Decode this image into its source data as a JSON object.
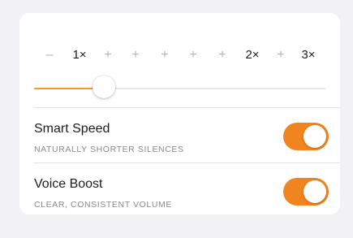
{
  "speed": {
    "ticks": [
      {
        "label": "–",
        "major": false
      },
      {
        "label": "1×",
        "major": true
      },
      {
        "label": "+",
        "major": false
      },
      {
        "label": "+",
        "major": false
      },
      {
        "label": "+",
        "major": false
      },
      {
        "label": "+",
        "major": false
      },
      {
        "label": "+",
        "major": false
      },
      {
        "label": "2×",
        "major": true
      },
      {
        "label": "+",
        "major": false
      },
      {
        "label": "3×",
        "major": true
      }
    ],
    "slider_level": 0.24,
    "accent_color": "#f39a2b"
  },
  "settings": [
    {
      "title": "Smart Speed",
      "subtitle": "NATURALLY SHORTER SILENCES",
      "on": true
    },
    {
      "title": "Voice Boost",
      "subtitle": "CLEAR, CONSISTENT VOLUME",
      "on": true
    }
  ],
  "toggle_color": "#f0841e"
}
